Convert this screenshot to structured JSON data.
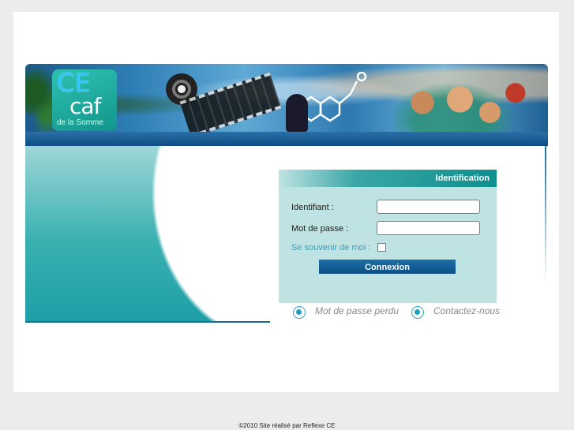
{
  "banner": {
    "logo_ce": "CE",
    "logo_caf": "caf",
    "logo_sub": "de la Somme"
  },
  "login": {
    "heading": "Identification",
    "username_label": "Identifiant :",
    "username_value": "",
    "password_label": "Mot de passe :",
    "password_value": "",
    "remember_label": "Se souvenir de moi :",
    "remember_checked": false,
    "submit_label": "Connexion"
  },
  "links": {
    "lost_password": "Mot de passe perdu",
    "contact": "Contactez-nous"
  },
  "footer": {
    "text": "©2010 Site réalisé par Reflexe CE"
  },
  "colors": {
    "teal": "#0f8f8e",
    "panel_bg": "#bfe3e3",
    "button": "#0c4f86",
    "link_accent": "#1d9fc4"
  }
}
